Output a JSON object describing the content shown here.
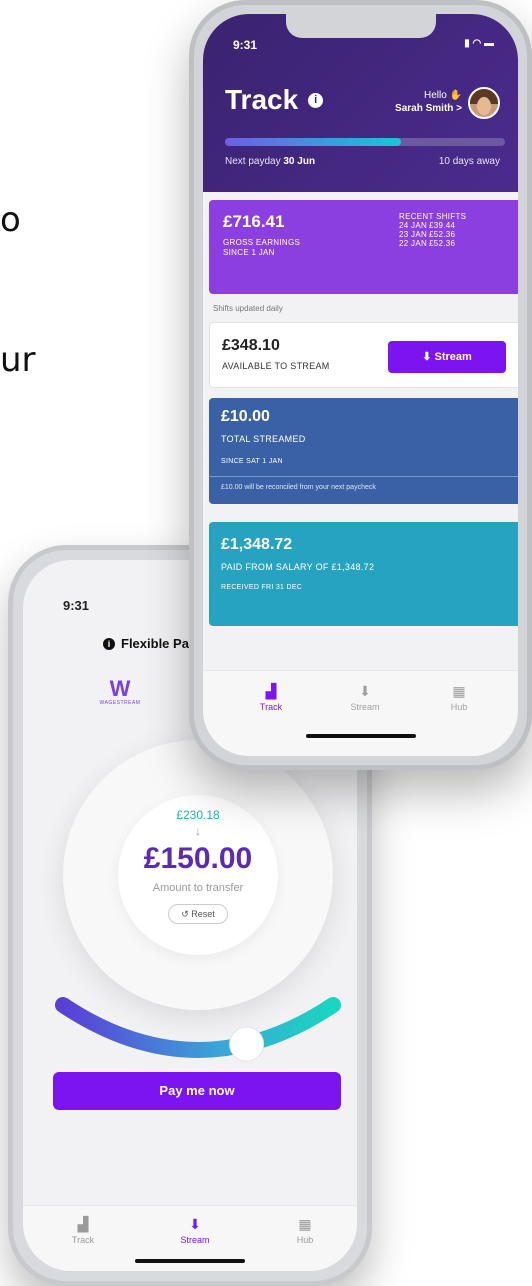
{
  "background": {
    "fragment_1": "o",
    "fragment_2": "ur"
  },
  "phone_back": {
    "time": "9:31",
    "title": "Flexible Pay",
    "logo_text": "WAGESTREAM",
    "original_amount": "£230.18",
    "arrow": "↓",
    "transfer_amount": "£150.00",
    "amount_label": "Amount to transfer",
    "reset_label": "↺ Reset",
    "slider_value": 0.68,
    "pay_button": "Pay me now",
    "nav": [
      {
        "label": "Track",
        "icon": "bar-chart-icon"
      },
      {
        "label": "Stream",
        "icon": "download-arrow-icon"
      },
      {
        "label": "Hub",
        "icon": "grid-icon"
      }
    ],
    "active_nav": "Stream"
  },
  "phone_front": {
    "time": "9:31",
    "title": "Track",
    "hello": "Hello",
    "user_name": "Sarah Smith >",
    "next_payday_label": "Next payday",
    "next_payday_date": "30 Jun",
    "days_away": "10 days away",
    "payday_progress": 0.63,
    "gross": {
      "amount": "£716.41",
      "label_1": "GROSS EARNINGS",
      "label_2": "SINCE 1 JAN",
      "shifts_title": "RECENT SHIFTS",
      "shifts": [
        {
          "date": "24 JAN",
          "amount": "£39.44"
        },
        {
          "date": "23 JAN",
          "amount": "£52.36"
        },
        {
          "date": "22 JAN",
          "amount": "£52.36"
        }
      ]
    },
    "shifts_note": "Shifts updated daily",
    "available": {
      "amount": "£348.10",
      "label": "AVAILABLE TO STREAM",
      "button": "Stream"
    },
    "streamed": {
      "amount": "£10.00",
      "label": "TOTAL STREAMED",
      "since": "SINCE SAT 1 JAN",
      "note": "£10.00 will be reconciled from your next paycheck"
    },
    "paid": {
      "amount": "£1,348.72",
      "label": "PAID FROM SALARY OF £1,348.72",
      "received": "RECEIVED FRI 31 DEC"
    },
    "nav": [
      {
        "label": "Track",
        "icon": "bar-chart-icon"
      },
      {
        "label": "Stream",
        "icon": "download-arrow-icon"
      },
      {
        "label": "Hub",
        "icon": "grid-icon"
      }
    ],
    "active_nav": "Track"
  },
  "colors": {
    "brand_purple": "#7b14f0",
    "header_purple": "#3a2370",
    "gross_card": "#8c3fe0",
    "streamed_card": "#3a61a6",
    "paid_card": "#26a3c0",
    "teal": "#19c6d8"
  }
}
